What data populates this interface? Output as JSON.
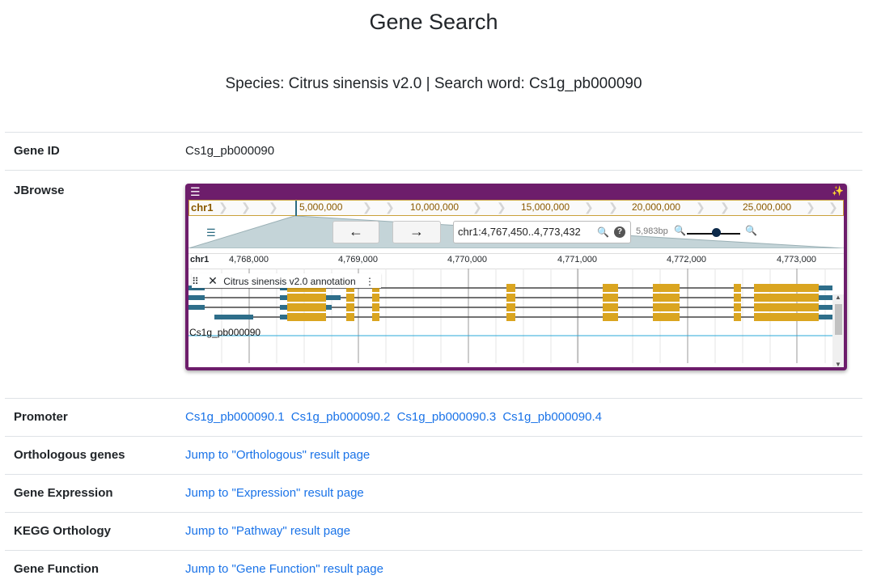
{
  "header": {
    "title": "Gene Search",
    "subtitle": "Species: Citrus sinensis v2.0 | Search word: Cs1g_pb000090"
  },
  "rows": {
    "gene_id": {
      "label": "Gene ID",
      "value": "Cs1g_pb000090"
    },
    "jbrowse": {
      "label": "JBrowse"
    },
    "promoter": {
      "label": "Promoter",
      "links": [
        "Cs1g_pb000090.1",
        "Cs1g_pb000090.2",
        "Cs1g_pb000090.3",
        "Cs1g_pb000090.4"
      ]
    },
    "orthologous": {
      "label": "Orthologous genes",
      "link": "Jump to \"Orthologous\" result page"
    },
    "expression": {
      "label": "Gene Expression",
      "link": "Jump to \"Expression\" result page"
    },
    "kegg": {
      "label": "KEGG Orthology",
      "link": "Jump to \"Pathway\" result page"
    },
    "function": {
      "label": "Gene Function",
      "link": "Jump to \"Gene Function\" result page"
    }
  },
  "jbrowse": {
    "menu_icon": "menu-icon",
    "logo_icon": "jbrowse-logo-icon",
    "overview": {
      "chr": "chr1",
      "ticks": [
        "5,000,000",
        "10,000,000",
        "15,000,000",
        "20,000,000",
        "25,000,000"
      ]
    },
    "nav": {
      "back_icon": "arrow-left-icon",
      "forward_icon": "arrow-right-icon",
      "location": "chr1:4,767,450..4,773,432",
      "search_icon": "search-icon",
      "help_icon": "help-icon",
      "help_glyph": "?",
      "bp": "5,983bp",
      "zoom_out_icon": "zoom-out-icon",
      "zoom_in_icon": "zoom-in-icon",
      "zoom_level": 0.55
    },
    "ruler": {
      "chr": "chr1",
      "ticks": [
        "4,768,000",
        "4,769,000",
        "4,770,000",
        "4,771,000",
        "4,772,000",
        "4,773,000"
      ]
    },
    "track": {
      "drag_icon": "drag-handle-icon",
      "close_icon": "close-icon",
      "title": "Citrus sinensis v2.0 annotation",
      "more_icon": "more-vert-icon",
      "gene_label": "Cs1g_pb000090",
      "utr_color": "#2e6e8a",
      "cds_color": "#daa520"
    }
  }
}
